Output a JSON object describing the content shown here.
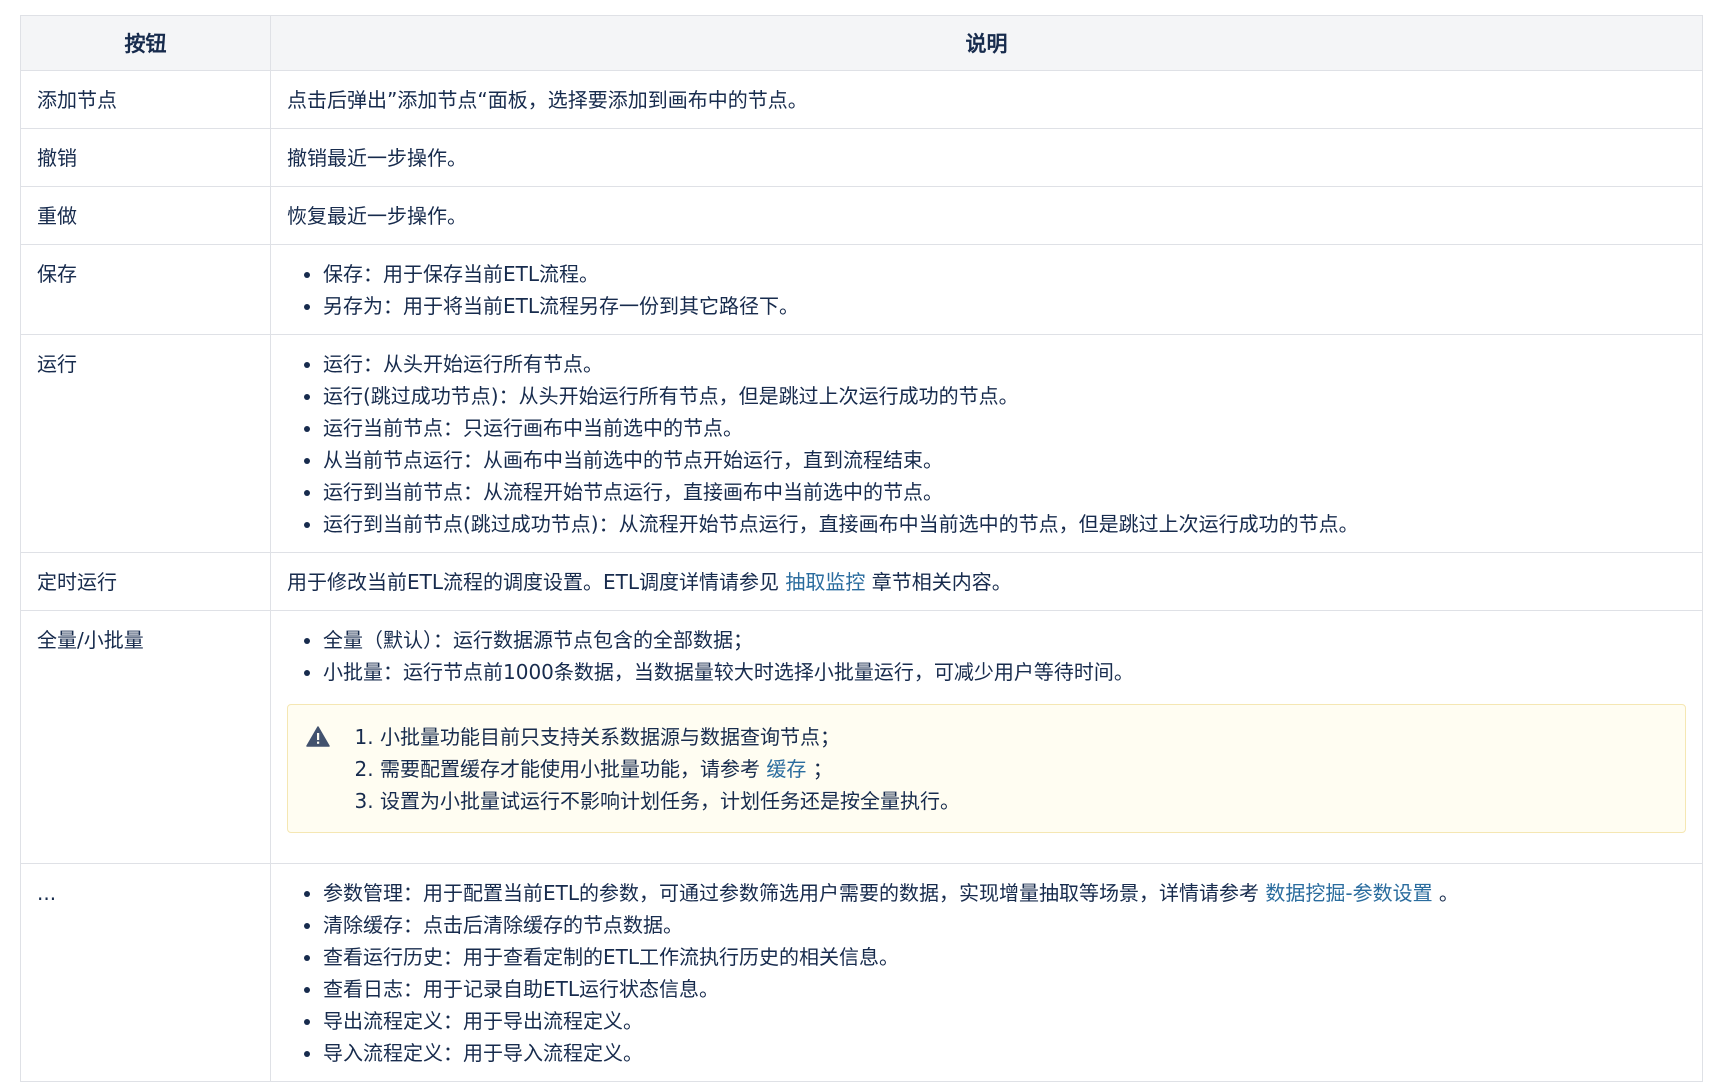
{
  "table": {
    "headers": [
      "按钮",
      "说明"
    ],
    "rows": {
      "add_node": {
        "name": "添加节点",
        "desc": "点击后弹出”添加节点“面板，选择要添加到画布中的节点。"
      },
      "undo": {
        "name": "撤销",
        "desc": "撤销最近一步操作。"
      },
      "redo": {
        "name": "重做",
        "desc": "恢复最近一步操作。"
      },
      "save": {
        "name": "保存",
        "items": [
          "保存：用于保存当前ETL流程。",
          "另存为：用于将当前ETL流程另存一份到其它路径下。"
        ]
      },
      "run": {
        "name": "运行",
        "items": [
          "运行：从头开始运行所有节点。",
          "运行(跳过成功节点)：从头开始运行所有节点，但是跳过上次运行成功的节点。",
          "运行当前节点：只运行画布中当前选中的节点。",
          "从当前节点运行：从画布中当前选中的节点开始运行，直到流程结束。",
          "运行到当前节点：从流程开始节点运行，直接画布中当前选中的节点。",
          "运行到当前节点(跳过成功节点)：从流程开始节点运行，直接画布中当前选中的节点，但是跳过上次运行成功的节点。"
        ]
      },
      "schedule": {
        "name": "定时运行",
        "desc_before": "用于修改当前ETL流程的调度设置。ETL调度详情请参见 ",
        "link": "抽取监控",
        "desc_after": " 章节相关内容。"
      },
      "batch": {
        "name": "全量/小批量",
        "items": [
          "全量（默认）：运行数据源节点包含的全部数据；",
          "小批量：运行节点前1000条数据，当数据量较大时选择小批量运行，可减少用户等待时间。"
        ],
        "note": {
          "icon": "warning-icon",
          "line1": "小批量功能目前只支持关系数据源与数据查询节点；",
          "line2_before": "需要配置缓存才能使用小批量功能，请参考 ",
          "line2_link": "缓存",
          "line2_after": " ；",
          "line3": "设置为小批量试运行不影响计划任务，计划任务还是按全量执行。"
        }
      },
      "more": {
        "name": "...",
        "item1_before": "参数管理：用于配置当前ETL的参数，可通过参数筛选用户需要的数据，实现增量抽取等场景，详情请参考 ",
        "item1_link": "数据挖掘-参数设置",
        "item1_after": " 。",
        "items": [
          "清除缓存：点击后清除缓存的节点数据。",
          "查看运行历史：用于查看定制的ETL工作流执行历史的相关信息。",
          "查看日志：用于记录自助ETL运行状态信息。",
          "导出流程定义：用于导出流程定义。",
          "导入流程定义：用于导入流程定义。"
        ]
      }
    }
  },
  "colors": {
    "link": "#2a6c9e",
    "text": "#172b4d",
    "header_bg": "#f4f5f7",
    "border": "#dfe1e6",
    "note_bg": "#fffdf2",
    "note_border": "#f5e7b3"
  }
}
